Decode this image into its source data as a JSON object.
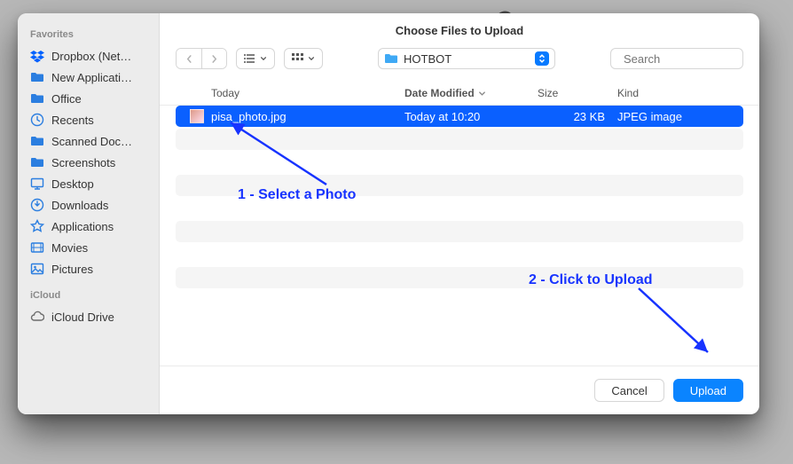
{
  "dialog": {
    "title": "Choose Files to Upload",
    "path_label": "HOTBOT",
    "search_placeholder": "Search",
    "cancel_label": "Cancel",
    "upload_label": "Upload"
  },
  "sidebar": {
    "favorites_label": "Favorites",
    "icloud_label": "iCloud",
    "items": [
      {
        "label": "Dropbox (Net…",
        "icon": "dropbox"
      },
      {
        "label": "New Applicati…",
        "icon": "folder"
      },
      {
        "label": "Office",
        "icon": "folder"
      },
      {
        "label": "Recents",
        "icon": "clock"
      },
      {
        "label": "Scanned Doc…",
        "icon": "folder"
      },
      {
        "label": "Screenshots",
        "icon": "folder"
      },
      {
        "label": "Desktop",
        "icon": "desktop"
      },
      {
        "label": "Downloads",
        "icon": "download"
      },
      {
        "label": "Applications",
        "icon": "apps"
      },
      {
        "label": "Movies",
        "icon": "movie"
      },
      {
        "label": "Pictures",
        "icon": "picture"
      }
    ],
    "icloud_items": [
      {
        "label": "iCloud Drive",
        "icon": "cloud"
      }
    ]
  },
  "columns": {
    "name_hint": "Today",
    "date": "Date Modified",
    "size": "Size",
    "kind": "Kind"
  },
  "files": [
    {
      "name": "pisa_photo.jpg",
      "date": "Today at 10:20",
      "size": "23 KB",
      "kind": "JPEG image",
      "selected": true
    }
  ],
  "annotations": {
    "step1": "1 - Select a Photo",
    "step2": "2 - Click to Upload"
  }
}
